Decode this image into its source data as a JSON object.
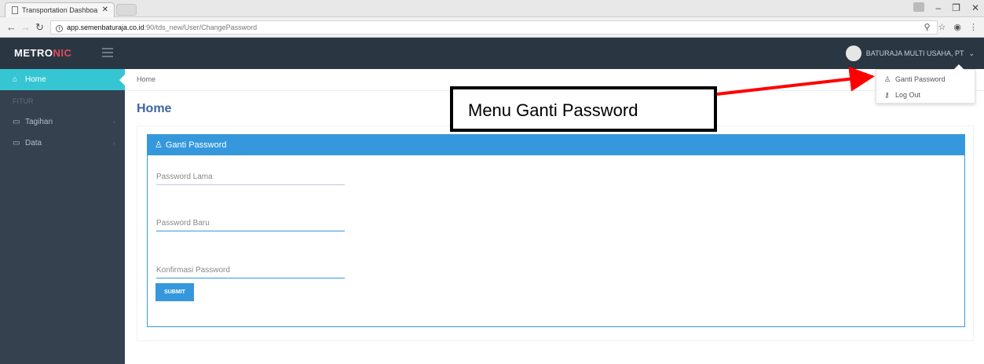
{
  "browser": {
    "tab_title": "Transportation Dashboa",
    "url_host": "app.semenbaturaja.co.id",
    "url_path": ":90/tds_new/User/ChangePassword"
  },
  "header": {
    "logo_main": "METRO",
    "logo_accent": "NIC",
    "user_name": "BATURAJA MULTI USAHA, PT"
  },
  "sidebar": {
    "items": [
      {
        "label": "Home",
        "icon": "home-icon"
      },
      {
        "label": "FITUR",
        "type": "heading"
      },
      {
        "label": "Tagihan",
        "icon": "bill-icon"
      },
      {
        "label": "Data",
        "icon": "monitor-icon"
      }
    ]
  },
  "main": {
    "breadcrumb": "Home",
    "page_title": "Home",
    "form": {
      "title": "Ganti Password",
      "fields": [
        {
          "placeholder": "Password Lama"
        },
        {
          "placeholder": "Password Baru"
        },
        {
          "placeholder": "Konfirmasi Password"
        }
      ],
      "submit_label": "SUBMIT"
    }
  },
  "dropdown": {
    "items": [
      {
        "label": "Ganti Password",
        "icon": "user-icon"
      },
      {
        "label": "Log Out",
        "icon": "key-icon"
      }
    ]
  },
  "annotation": {
    "text": "Menu Ganti Password",
    "arrow_color": "#ff0000"
  },
  "colors": {
    "header_bg": "#2b3643",
    "sidebar_bg": "#364150",
    "active_item": "#36c6d3",
    "primary": "#3598dc"
  }
}
